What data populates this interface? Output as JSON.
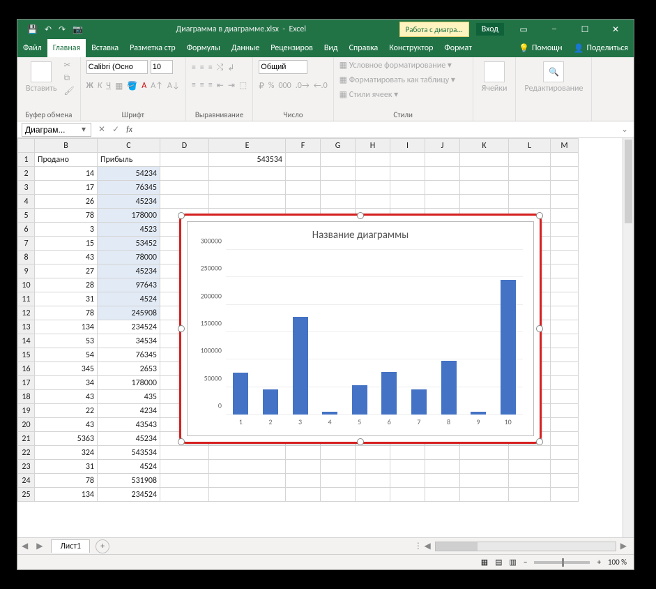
{
  "title": {
    "doc": "Диаграмма в диаграмме.xlsx",
    "app": "Excel",
    "context_tab": "Работа с диагра...",
    "login": "Вход"
  },
  "qat": {
    "save": "💾",
    "undo": "↶",
    "redo": "↷",
    "cam": "📷"
  },
  "tabs": {
    "file": "Файл",
    "home": "Главная",
    "insert": "Вставка",
    "layout": "Разметка стр",
    "formulas": "Формулы",
    "data": "Данные",
    "review": "Рецензиров",
    "view": "Вид",
    "help": "Справка",
    "design": "Конструктор",
    "format": "Формат",
    "tellme": "Помощн",
    "share": "Поделиться"
  },
  "ribbon": {
    "paste": "Вставить",
    "clipboard": "Буфер обмена",
    "font_name": "Calibri (Осно",
    "font_size": "10",
    "font_group": "Шрифт",
    "align_group": "Выравнивание",
    "number_fmt": "Общий",
    "number_group": "Число",
    "cond_fmt": "Условное форматирование",
    "as_table": "Форматировать как таблицу",
    "cell_styles": "Стили ячеек",
    "styles_group": "Стили",
    "cells": "Ячейки",
    "editing": "Редактирование"
  },
  "name_box": "Диаграм...",
  "columns": [
    "B",
    "C",
    "D",
    "E",
    "F",
    "G",
    "H",
    "I",
    "J",
    "K",
    "L",
    "M"
  ],
  "headers": {
    "B": "Продано",
    "C": "Прибыль"
  },
  "rows": [
    {
      "n": 1,
      "B": "Продано",
      "C": "Прибыль",
      "E": "543534"
    },
    {
      "n": 2,
      "B": "14",
      "C": "54234"
    },
    {
      "n": 3,
      "B": "17",
      "C": "76345"
    },
    {
      "n": 4,
      "B": "26",
      "C": "45234"
    },
    {
      "n": 5,
      "B": "78",
      "C": "178000"
    },
    {
      "n": 6,
      "B": "3",
      "C": "4523"
    },
    {
      "n": 7,
      "B": "15",
      "C": "53452"
    },
    {
      "n": 8,
      "B": "43",
      "C": "78000"
    },
    {
      "n": 9,
      "B": "27",
      "C": "45234"
    },
    {
      "n": 10,
      "B": "28",
      "C": "97643"
    },
    {
      "n": 11,
      "B": "31",
      "C": "4524"
    },
    {
      "n": 12,
      "B": "78",
      "C": "245908"
    },
    {
      "n": 13,
      "B": "134",
      "C": "234524"
    },
    {
      "n": 14,
      "B": "53",
      "C": "34534"
    },
    {
      "n": 15,
      "B": "54",
      "C": "76345"
    },
    {
      "n": 16,
      "B": "345",
      "C": "2653"
    },
    {
      "n": 17,
      "B": "34",
      "C": "178000"
    },
    {
      "n": 18,
      "B": "43",
      "C": "435"
    },
    {
      "n": 19,
      "B": "22",
      "C": "4234"
    },
    {
      "n": 20,
      "B": "43",
      "C": "43543"
    },
    {
      "n": 21,
      "B": "5363",
      "C": "45234"
    },
    {
      "n": 22,
      "B": "324",
      "C": "543534"
    },
    {
      "n": 23,
      "B": "31",
      "C": "4524"
    },
    {
      "n": 24,
      "B": "78",
      "C": "531908"
    },
    {
      "n": 25,
      "B": "134",
      "C": "234524"
    }
  ],
  "selection": {
    "start_row": 2,
    "end_row": 12,
    "col": "C"
  },
  "sheet_tab": "Лист1",
  "zoom": "100 %",
  "chart_data": {
    "type": "bar",
    "title": "Название диаграммы",
    "categories": [
      "1",
      "2",
      "3",
      "4",
      "5",
      "6",
      "7",
      "8",
      "9",
      "10"
    ],
    "values": [
      76345,
      45234,
      178000,
      4523,
      53452,
      78000,
      45234,
      97643,
      4524,
      245908
    ],
    "yticks": [
      "0",
      "50000",
      "100000",
      "150000",
      "200000",
      "250000",
      "300000"
    ],
    "ylim": [
      0,
      300000
    ],
    "xlabel": "",
    "ylabel": ""
  }
}
